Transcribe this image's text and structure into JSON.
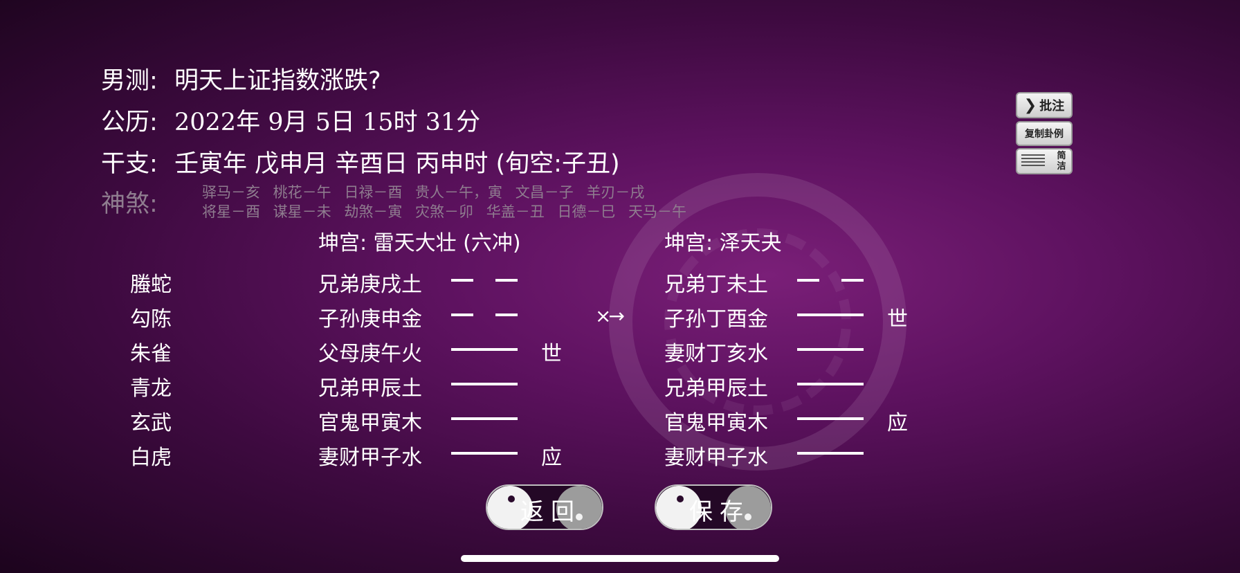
{
  "header": {
    "question_label": "男测:",
    "question": "明天上证指数涨跌?",
    "date_label": "公历:",
    "date": "2022年 9月 5日 15时 31分",
    "ganzhi_label": "干支:",
    "ganzhi": "壬寅年 戊申月 辛酉日 丙申时 (旬空:子丑)"
  },
  "shensha": {
    "label": "神煞:",
    "line1": "驿马－亥 桃花－午 日禄－酉 贵人－午，寅 文昌－子 羊刃－戌",
    "line2": "将星－酉 谋星－未 劫煞－寅 灾煞－卯 华盖－丑 日德－巳 天马－午"
  },
  "ben_gua": {
    "title": "坤宫: 雷天大壮 (六冲)",
    "yao": [
      {
        "text": "兄弟庚戌土",
        "line": "yin",
        "mark": ""
      },
      {
        "text": "子孙庚申金",
        "line": "yin",
        "mark": ""
      },
      {
        "text": "父母庚午火",
        "line": "yang",
        "mark": "世"
      },
      {
        "text": "兄弟甲辰土",
        "line": "yang",
        "mark": ""
      },
      {
        "text": "官鬼甲寅木",
        "line": "yang",
        "mark": ""
      },
      {
        "text": "妻财甲子水",
        "line": "yang",
        "mark": "应"
      }
    ]
  },
  "bian_gua": {
    "title": "坤宫: 泽天夬",
    "change_marker": "×→",
    "yao": [
      {
        "text": "兄弟丁未土",
        "line": "yin",
        "mark": ""
      },
      {
        "text": "子孙丁酉金",
        "line": "yang",
        "mark": "世"
      },
      {
        "text": "妻财丁亥水",
        "line": "yang",
        "mark": ""
      },
      {
        "text": "兄弟甲辰土",
        "line": "yang",
        "mark": ""
      },
      {
        "text": "官鬼甲寅木",
        "line": "yang",
        "mark": "应"
      },
      {
        "text": "妻财甲子水",
        "line": "yang",
        "mark": ""
      }
    ]
  },
  "liushen": [
    "螣蛇",
    "勾陈",
    "朱雀",
    "青龙",
    "玄武",
    "白虎"
  ],
  "side_buttons": {
    "annotate": "批注",
    "copy_example": "复制卦例",
    "simple_label": "简洁"
  },
  "bottom_buttons": {
    "back": "返回",
    "save": "保存"
  },
  "colors": {
    "background": "#5e1260",
    "text": "#ffffff",
    "muted": "#8f7d8f"
  }
}
